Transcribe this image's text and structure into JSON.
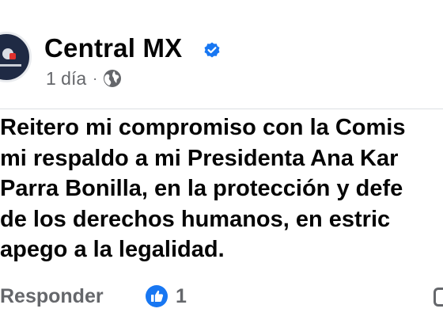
{
  "post": {
    "page_name": "Central MX",
    "time": "1 día",
    "separator": "·",
    "privacy_icon": "globe-icon",
    "verified_icon": "verified-badge-icon"
  },
  "comment": {
    "lines": [
      "Reitero mi compromiso con la Comis",
      "mi respaldo a mi Presidenta Ana Kar",
      "Parra Bonilla, en la protección y defe",
      "de los derechos humanos, en estric",
      "apego a la legalidad."
    ],
    "reply_label": "Responder",
    "like_count": "1",
    "like_icon": "like-thumb-icon"
  },
  "colors": {
    "text_primary": "#050505",
    "text_secondary": "#65676b",
    "accent_blue": "#1877f2"
  }
}
